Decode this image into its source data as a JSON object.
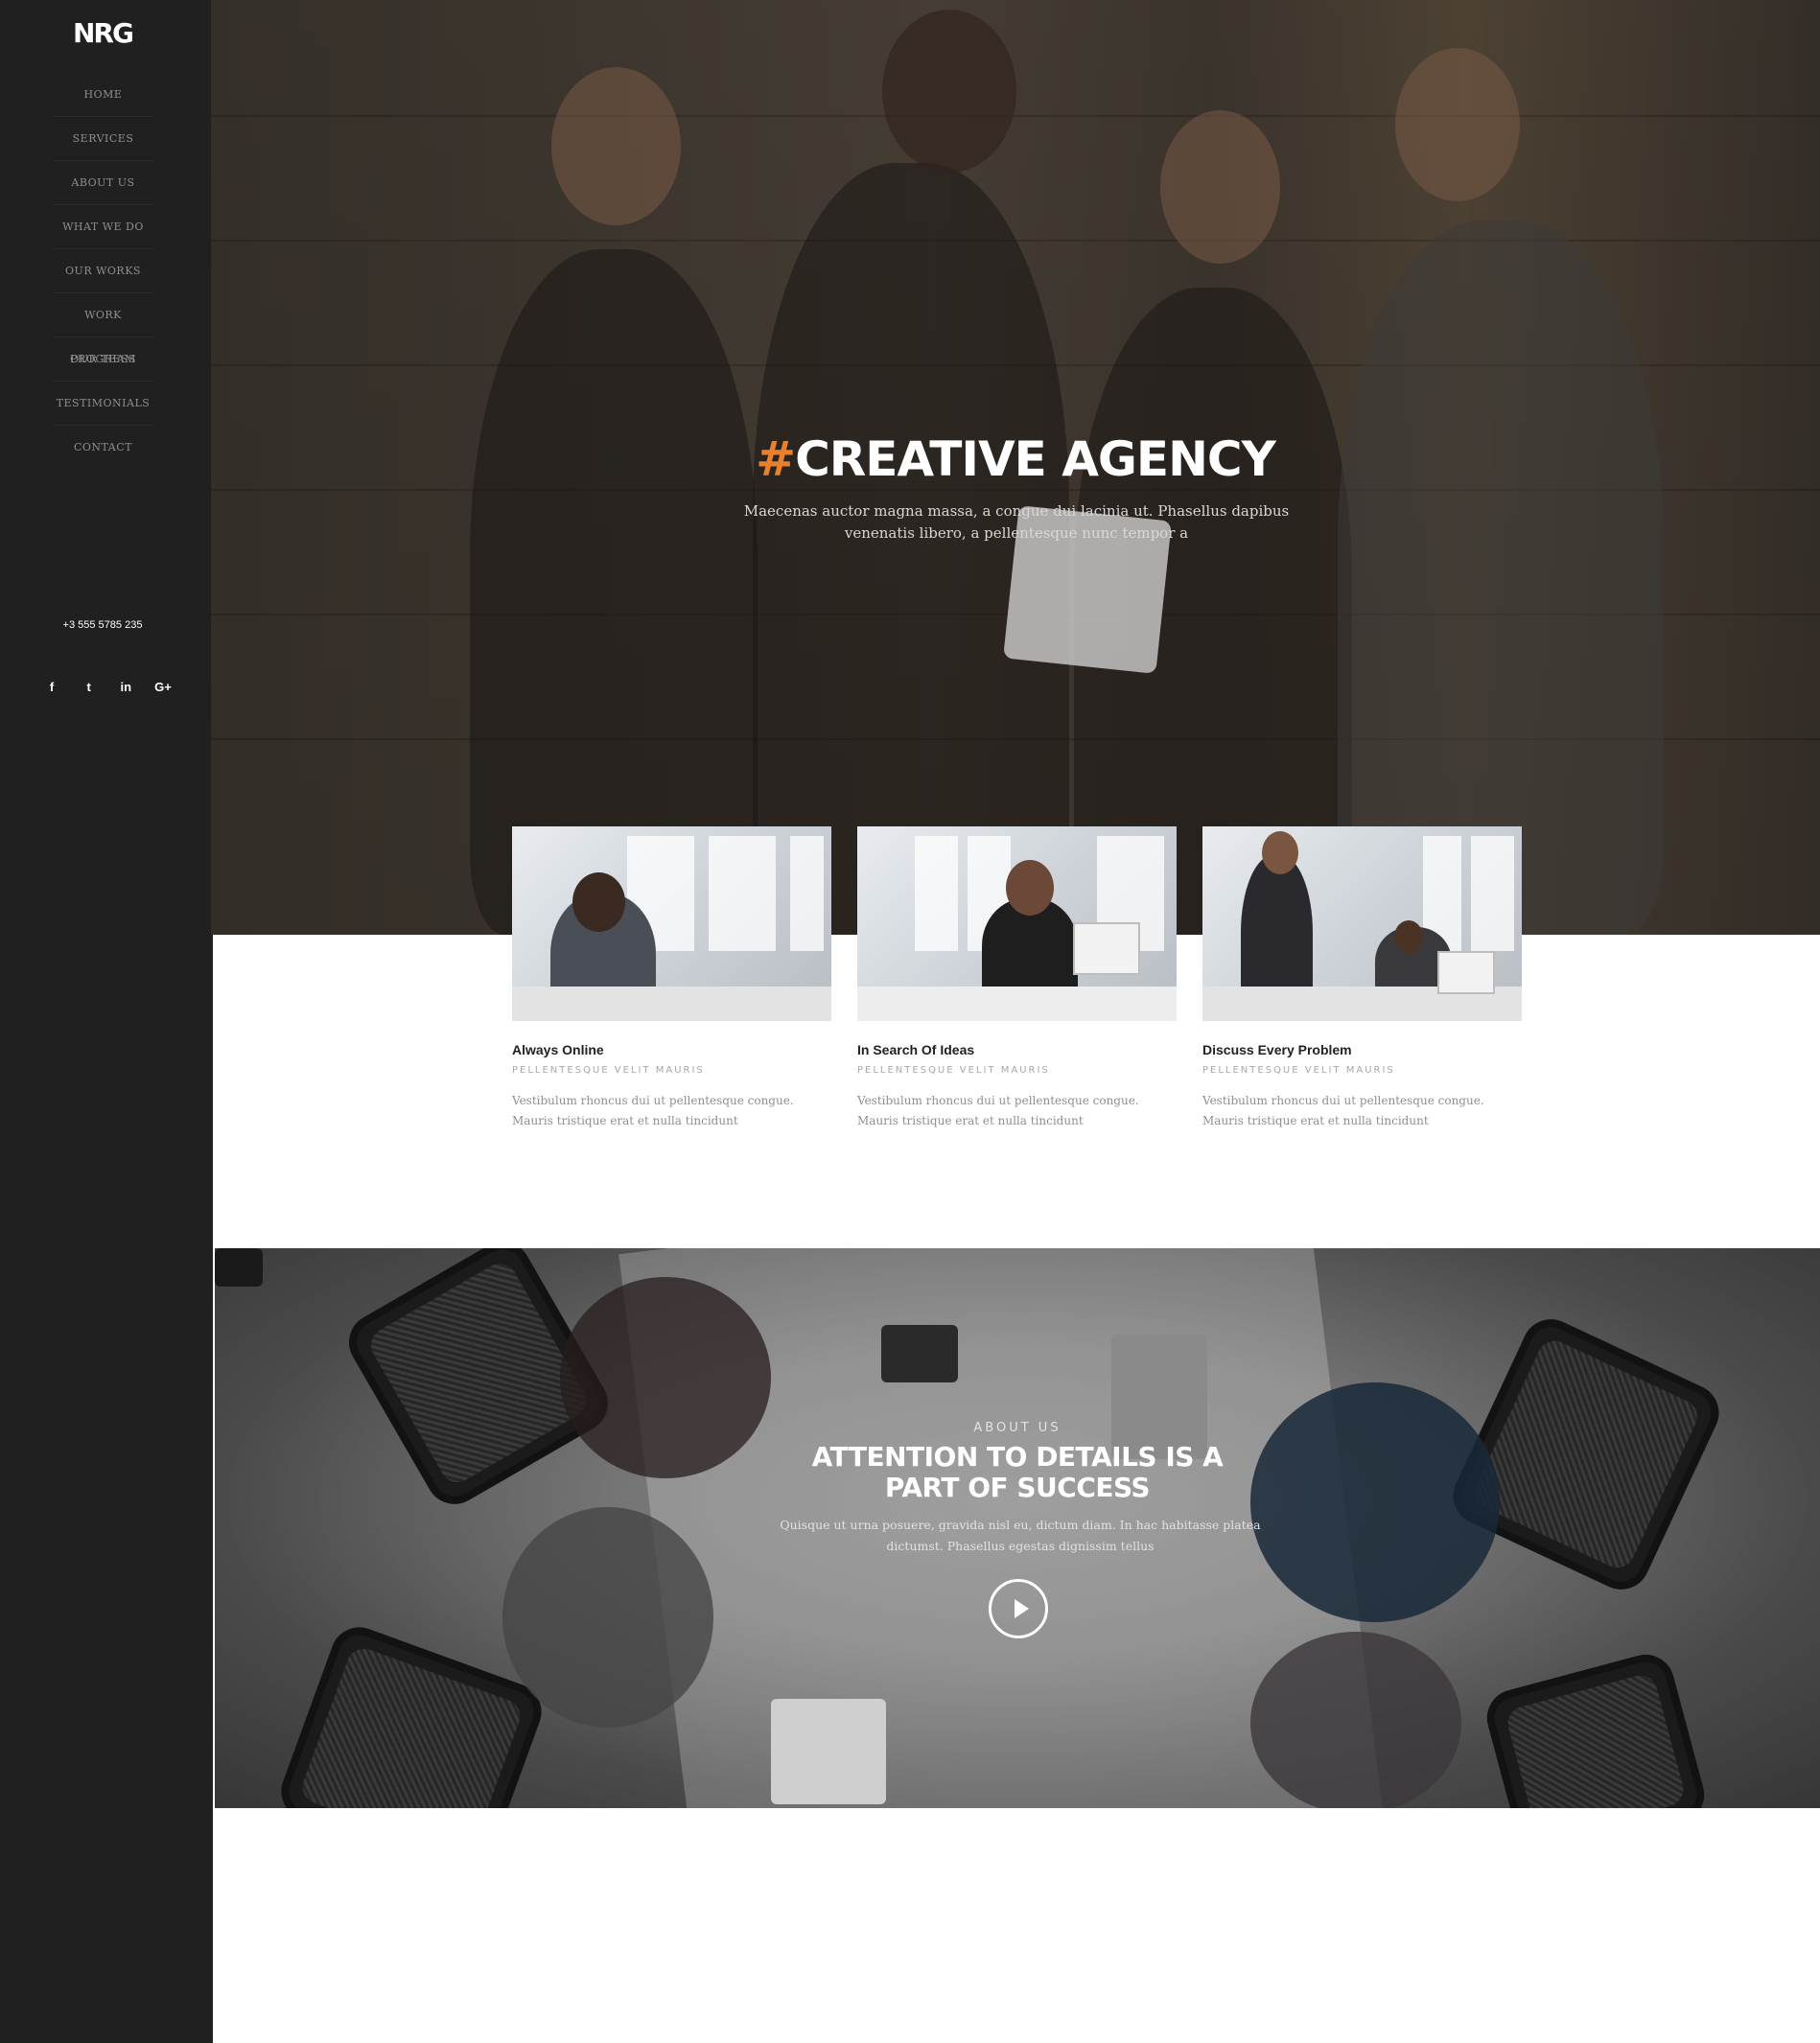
{
  "brand": {
    "logo_text": "NRG"
  },
  "sidebar": {
    "nav": [
      {
        "label": "HOME"
      },
      {
        "label": "SERVICES"
      },
      {
        "label": "ABOUT US"
      },
      {
        "label": "WHAT WE DO"
      },
      {
        "label": "OUR WORKS"
      },
      {
        "label": "WORK PROGRESS"
      },
      {
        "label": "OUR TEAM"
      },
      {
        "label": "TESTIMONIALS"
      },
      {
        "label": "CONTACT"
      }
    ],
    "phone": "+3 555 5785 235",
    "socials": [
      {
        "icon": "facebook-icon",
        "glyph": "f"
      },
      {
        "icon": "twitter-icon",
        "glyph": "t"
      },
      {
        "icon": "linkedin-icon",
        "glyph": "in"
      },
      {
        "icon": "google-plus-icon",
        "glyph": "G+"
      }
    ]
  },
  "hero": {
    "hash": "#",
    "title": "CREATIVE AGENCY",
    "subtitle": "Maecenas auctor magna massa, a congue dui lacinia ut. Phasellus dapibus venenatis libero, a pellentesque nunc tempor a"
  },
  "cards": [
    {
      "title": "Always Online",
      "tag": "PELLENTESQUE VELIT MAURIS",
      "text": "Vestibulum rhoncus dui ut pellentesque congue. Mauris tristique erat et nulla tincidunt"
    },
    {
      "title": "In Search Of Ideas",
      "tag": "PELLENTESQUE VELIT MAURIS",
      "text": "Vestibulum rhoncus dui ut pellentesque congue. Mauris tristique erat et nulla tincidunt"
    },
    {
      "title": "Discuss Every Problem",
      "tag": "PELLENTESQUE VELIT MAURIS",
      "text": "Vestibulum rhoncus dui ut pellentesque congue. Mauris tristique erat et nulla tincidunt"
    }
  ],
  "about": {
    "label": "ABOUT US",
    "title": "ATTENTION TO DETAILS IS A PART OF SUCCESS",
    "subtitle": "Quisque ut urna posuere, gravida nisl eu, dictum diam. In hac habitasse platea dictumst. Phasellus egestas dignissim tellus"
  },
  "colors": {
    "accent": "#e8802c",
    "sidebar_bg": "#202020"
  }
}
